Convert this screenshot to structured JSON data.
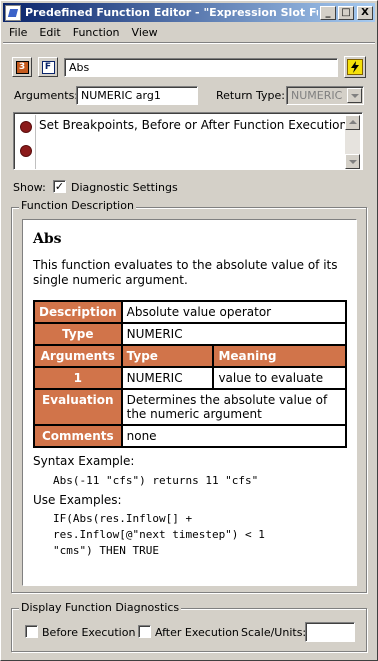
{
  "window": {
    "title": "Predefined Function Editor - \"Expression Slot Funct...",
    "minimize": "_",
    "maximize": "□",
    "close": "X"
  },
  "menu": [
    "File",
    "Edit",
    "Function",
    "View"
  ],
  "toolbar": {
    "function_name": "Abs"
  },
  "arguments": {
    "label": "Arguments:",
    "value": "NUMERIC arg1",
    "return_type_label": "Return Type:",
    "return_type_value": "NUMERIC"
  },
  "breakpoints": {
    "text": "Set Breakpoints, Before or After Function Execution."
  },
  "show": {
    "label": "Show:",
    "diagnostic_label": "Diagnostic Settings",
    "diagnostic_checked": true
  },
  "function_description": {
    "group_title": "Function Description",
    "name": "Abs",
    "description": "This function evaluates to the absolute value of its single numeric argument.",
    "table": {
      "description_header": "Description",
      "description_value": "Absolute value operator",
      "type_header": "Type",
      "type_value": "NUMERIC",
      "arguments_header": "Arguments",
      "col_type_header": "Type",
      "col_meaning_header": "Meaning",
      "arg_index": "1",
      "arg_type": "NUMERIC",
      "arg_meaning": "value to evaluate",
      "evaluation_header": "Evaluation",
      "evaluation_value": "Determines the absolute value of the numeric argument",
      "comments_header": "Comments",
      "comments_value": "none"
    },
    "syntax_heading": "Syntax Example:",
    "syntax_example": "Abs(-11 \"cfs\") returns 11 \"cfs\"",
    "use_heading": "Use Examples:",
    "use_example_lines": [
      "IF(Abs(res.Inflow[] +",
      "res.Inflow[@\"next timestep\") < 1",
      "\"cms\") THEN TRUE"
    ]
  },
  "diagnostics": {
    "group_title": "Display Function Diagnostics",
    "before_label": "Before Execution",
    "after_label": "After Execution",
    "scale_label": "Scale/Units:",
    "scale_value": ""
  },
  "colors": {
    "title_bar_start": "#0a246a",
    "title_bar_end": "#a6caf0",
    "table_header": "#d1744a",
    "breakpoint_dot": "#8b1a1a"
  }
}
